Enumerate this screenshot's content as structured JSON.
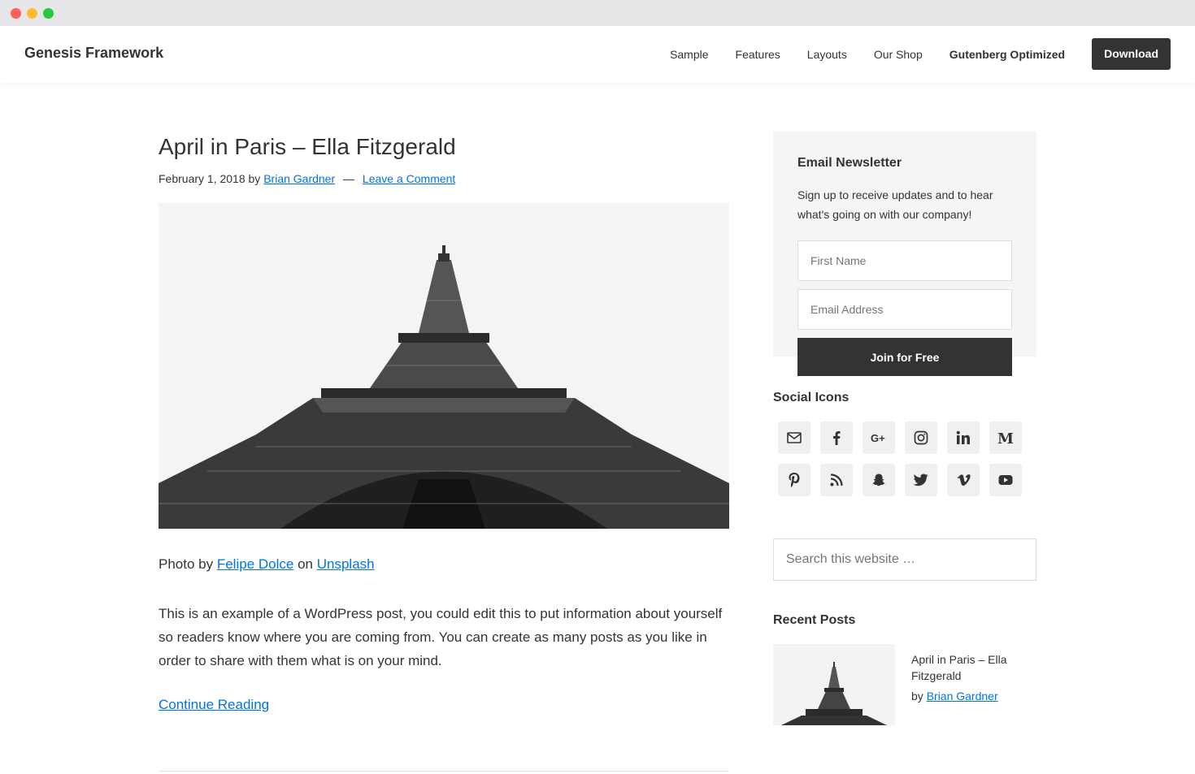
{
  "site": {
    "title": "Genesis Framework",
    "nav": [
      {
        "label": "Sample"
      },
      {
        "label": "Features"
      },
      {
        "label": "Layouts"
      },
      {
        "label": "Our Shop"
      },
      {
        "label": "Gutenberg Optimized"
      }
    ],
    "download_label": "Download"
  },
  "post": {
    "title": "April in Paris – Ella Fitzgerald",
    "date": "February 1, 2018",
    "by": "by",
    "author": "Brian Gardner",
    "separator": "—",
    "comment_link": "Leave a Comment",
    "credit_prefix": "Photo by",
    "credit_photographer": "Felipe Dolce",
    "credit_on": "on",
    "credit_site": "Unsplash",
    "body": "This is an example of a WordPress post, you could edit this to put information about yourself so readers know where you are coming from. You can create as many posts as you like in order to share with them what is on your mind.",
    "continue": "Continue Reading"
  },
  "sidebar": {
    "newsletter": {
      "title": "Email Newsletter",
      "text": "Sign up to receive updates and to hear what's going on with our company!",
      "first_name_placeholder": "First Name",
      "email_placeholder": "Email Address",
      "button": "Join for Free"
    },
    "social": {
      "title": "Social Icons",
      "icons": [
        "email-icon",
        "facebook-icon",
        "google-plus-icon",
        "instagram-icon",
        "linkedin-icon",
        "medium-icon",
        "pinterest-icon",
        "rss-icon",
        "snapchat-icon",
        "twitter-icon",
        "vimeo-icon",
        "youtube-icon"
      ]
    },
    "search_placeholder": "Search this website …",
    "recent": {
      "title": "Recent Posts",
      "items": [
        {
          "title": "April in Paris – Ella Fitzgerald",
          "by": "by",
          "author": "Brian Gardner"
        }
      ]
    }
  },
  "colors": {
    "link": "#0073e5",
    "dark": "#333333",
    "panel": "#f5f5f5"
  }
}
